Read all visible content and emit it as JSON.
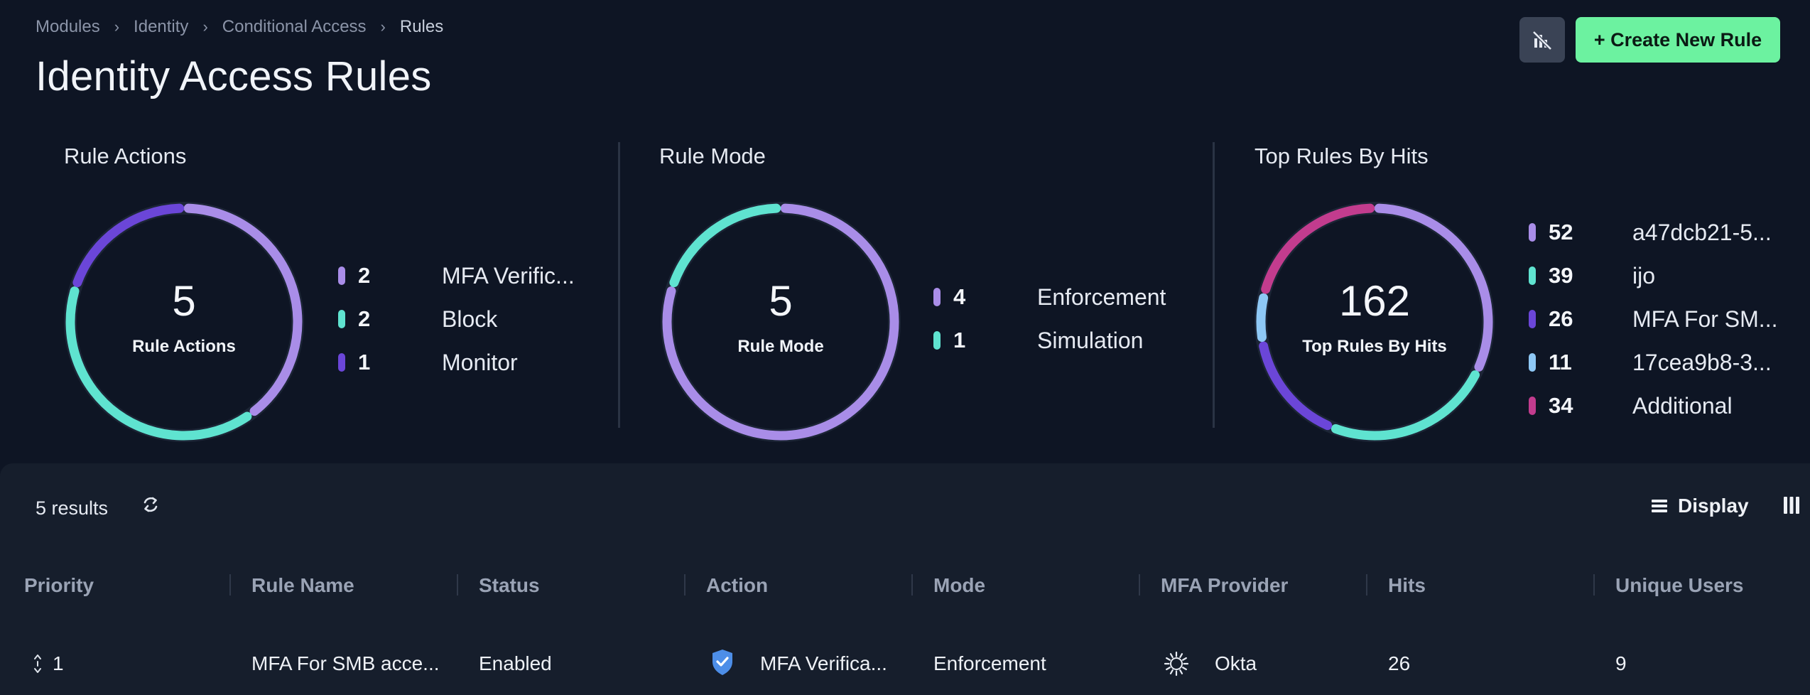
{
  "breadcrumb": [
    "Modules",
    "Identity",
    "Conditional Access",
    "Rules"
  ],
  "page_title": "Identity Access Rules",
  "header": {
    "create_button": "+ Create New Rule",
    "filter_icon": "chart-off-icon"
  },
  "colors": {
    "lavender": "#a98de8",
    "teal": "#5fe3d0",
    "violet": "#6b46d8",
    "sky": "#8ec8f5",
    "magenta": "#c23c8e",
    "green": "#6cf2a0"
  },
  "cards": [
    {
      "title": "Rule Actions",
      "total": "5",
      "center_label": "Rule Actions",
      "items": [
        {
          "count": "2",
          "name": "MFA Verific...",
          "color": "#a98de8",
          "value": 2
        },
        {
          "count": "2",
          "name": "Block",
          "color": "#5fe3d0",
          "value": 2
        },
        {
          "count": "1",
          "name": "Monitor",
          "color": "#6b46d8",
          "value": 1
        }
      ]
    },
    {
      "title": "Rule Mode",
      "total": "5",
      "center_label": "Rule Mode",
      "items": [
        {
          "count": "4",
          "name": "Enforcement",
          "color": "#a98de8",
          "value": 4
        },
        {
          "count": "1",
          "name": "Simulation",
          "color": "#5fe3d0",
          "value": 1
        }
      ]
    },
    {
      "title": "Top Rules By Hits",
      "total": "162",
      "center_label": "Top Rules By Hits",
      "items": [
        {
          "count": "52",
          "name": "a47dcb21-5...",
          "color": "#a98de8",
          "value": 52
        },
        {
          "count": "39",
          "name": "ijo",
          "color": "#5fe3d0",
          "value": 39
        },
        {
          "count": "26",
          "name": "MFA For SM...",
          "color": "#6b46d8",
          "value": 26
        },
        {
          "count": "11",
          "name": "17cea9b8-3...",
          "color": "#8ec8f5",
          "value": 11
        },
        {
          "count": "34",
          "name": "Additional",
          "color": "#c23c8e",
          "value": 34
        }
      ]
    }
  ],
  "table": {
    "results_label": "5 results",
    "display_label": "Display",
    "columns": [
      "Priority",
      "Rule Name",
      "Status",
      "Action",
      "Mode",
      "MFA Provider",
      "Hits",
      "Unique Users"
    ],
    "rows": [
      {
        "priority": "1",
        "rule_name": "MFA For SMB acce...",
        "status": "Enabled",
        "action": "MFA Verifica...",
        "mode": "Enforcement",
        "mfa_provider": "Okta",
        "hits": "26",
        "unique_users": "9"
      }
    ]
  }
}
